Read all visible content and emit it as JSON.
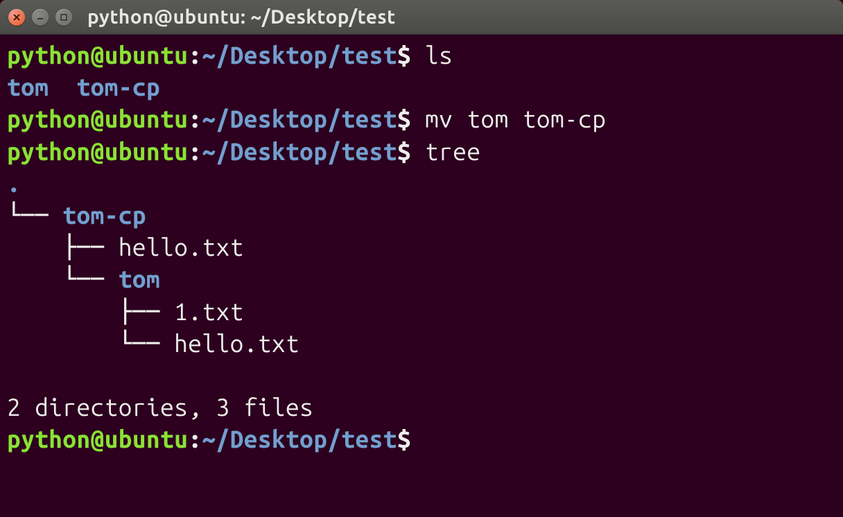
{
  "window": {
    "title": "python@ubuntu: ~/Desktop/test"
  },
  "prompt": {
    "userhost": "python@ubuntu",
    "colon": ":",
    "path": "~/Desktop/test",
    "symbol": "$"
  },
  "lines": {
    "cmd1": "ls",
    "ls_out1": "tom",
    "ls_out2": "tom-cp",
    "cmd2": "mv tom tom-cp",
    "cmd3": "tree",
    "tree_root": ".",
    "tree_b1": "└── ",
    "tree_d1": "tom-cp",
    "tree_b2": "    ├── ",
    "tree_f1": "hello.txt",
    "tree_b3": "    └── ",
    "tree_d2": "tom",
    "tree_b4": "        ├── ",
    "tree_f2": "1.txt",
    "tree_b5": "        └── ",
    "tree_f3": "hello.txt",
    "summary": "2 directories, 3 files"
  }
}
